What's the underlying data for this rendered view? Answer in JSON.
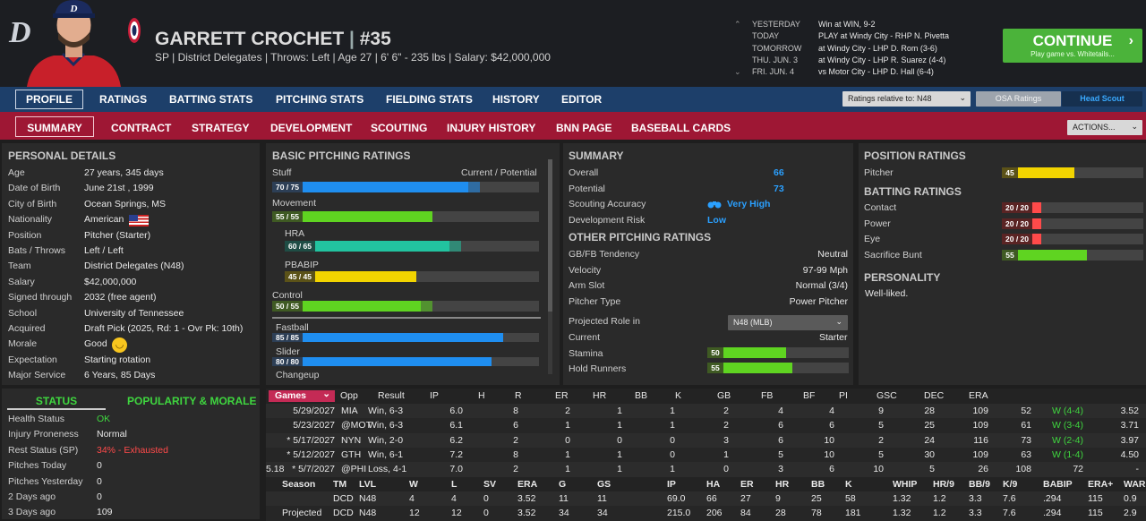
{
  "logo": "D",
  "player": {
    "name": "GARRETT CROCHET",
    "number": "#35",
    "info": "SP | District Delegates  |  Throws: Left  |  Age 27  |  6' 6\" - 235 lbs  |  Salary: $42,000,000"
  },
  "schedule": [
    {
      "day": "YESTERDAY",
      "text": "Win at WIN, 9-2"
    },
    {
      "day": "TODAY",
      "text": "PLAY at Windy City - RHP N. Pivetta"
    },
    {
      "day": "TOMORROW",
      "text": "at Windy City - LHP D. Rom (3-6)"
    },
    {
      "day": "THU. JUN. 3",
      "text": "at Windy City - LHP R. Suarez (4-4)"
    },
    {
      "day": "FRI. JUN. 4",
      "text": "vs Motor City - LHP D. Hall (6-4)"
    }
  ],
  "continue": {
    "label": "CONTINUE",
    "sub": "Play game vs. Whitetails..."
  },
  "nav1": [
    "PROFILE",
    "RATINGS",
    "BATTING STATS",
    "PITCHING STATS",
    "FIELDING STATS",
    "HISTORY",
    "EDITOR"
  ],
  "ratings_relative": "Ratings relative to: N48",
  "osa": "OSA Ratings",
  "head_scout": "Head Scout",
  "nav2": [
    "SUMMARY",
    "CONTRACT",
    "STRATEGY",
    "DEVELOPMENT",
    "SCOUTING",
    "INJURY HISTORY",
    "BNN PAGE",
    "BASEBALL CARDS"
  ],
  "actions": "ACTIONS...",
  "personal": {
    "title": "PERSONAL DETAILS",
    "rows": [
      [
        "Age",
        "27 years, 345 days"
      ],
      [
        "Date of Birth",
        "June 21st , 1999"
      ],
      [
        "City of Birth",
        "Ocean Springs, MS"
      ],
      [
        "Nationality",
        "American"
      ],
      [
        "Position",
        "Pitcher (Starter)"
      ],
      [
        "Bats / Throws",
        "Left / Left"
      ],
      [
        "Team",
        "District Delegates (N48)"
      ],
      [
        "Salary",
        "$42,000,000"
      ],
      [
        "Signed through",
        "2032 (free agent)"
      ],
      [
        "School",
        "University of Tennessee"
      ],
      [
        "Acquired",
        "Draft Pick (2025, Rd: 1 - Ovr Pk: 10th)"
      ],
      [
        "Morale",
        "Good"
      ],
      [
        "Expectation",
        "Starting rotation"
      ],
      [
        "Major Service",
        "6 Years, 85 Days"
      ]
    ]
  },
  "status": {
    "tab1": "STATUS",
    "tab2": "POPULARITY & MORALE",
    "rows": [
      [
        "Health Status",
        "OK"
      ],
      [
        "Injury Proneness",
        "Normal"
      ],
      [
        "Rest Status (SP)",
        "34% - Exhausted"
      ],
      [
        "Pitches Today",
        "0"
      ],
      [
        "Pitches Yesterday",
        "0"
      ],
      [
        "2 Days ago",
        "0"
      ],
      [
        "3 Days ago",
        "109"
      ]
    ]
  },
  "basic": {
    "title": "BASIC PITCHING RATINGS",
    "left": "Stuff",
    "right": "Current / Potential",
    "items": [
      {
        "name": "",
        "label": "70 / 75",
        "cur": 70,
        "pot": 75,
        "color": "#1f8ef0"
      },
      {
        "name": "Movement",
        "label": "55 / 55",
        "cur": 55,
        "pot": 55,
        "color": "#5fd421"
      },
      {
        "name": "HRA",
        "label": "60 / 65",
        "cur": 60,
        "pot": 65,
        "color": "#22c3a0"
      },
      {
        "name": "PBABIP",
        "label": "45 / 45",
        "cur": 45,
        "pot": 45,
        "color": "#f2d400"
      },
      {
        "name": "Control",
        "label": "50 / 55",
        "cur": 50,
        "pot": 55,
        "color": "#5fd421"
      }
    ],
    "pitches": [
      {
        "name": "Fastball",
        "label": "85 / 85",
        "cur": 85,
        "color": "#1f8ef0"
      },
      {
        "name": "Slider",
        "label": "80 / 80",
        "cur": 80,
        "color": "#1f8ef0"
      },
      {
        "name": "Changeup",
        "label": "",
        "cur": 0,
        "color": "#1f8ef0"
      }
    ]
  },
  "summary": {
    "title": "SUMMARY",
    "rows": [
      [
        "Overall",
        "66"
      ],
      [
        "Potential",
        "73"
      ]
    ],
    "scout": [
      "Scouting Accuracy",
      "Very High"
    ],
    "risk": [
      "Development Risk",
      "Low"
    ]
  },
  "other": {
    "title": "OTHER PITCHING RATINGS",
    "rows": [
      [
        "GB/FB Tendency",
        "Neutral"
      ],
      [
        "Velocity",
        "97-99 Mph"
      ],
      [
        "Arm Slot",
        "Normal (3/4)"
      ],
      [
        "Pitcher Type",
        "Power Pitcher"
      ]
    ],
    "role_label": "Projected Role in",
    "role_value": "N48 (MLB)",
    "current_label": "Current",
    "current_value": "Starter",
    "stamina": {
      "name": "Stamina",
      "v": 50
    },
    "hold": {
      "name": "Hold Runners",
      "v": 55
    }
  },
  "position": {
    "title": "POSITION RATINGS",
    "pitcher": {
      "name": "Pitcher",
      "v": 45
    }
  },
  "batting": {
    "title": "BATTING RATINGS",
    "items": [
      {
        "name": "Contact",
        "label": "20 / 20",
        "v": 20
      },
      {
        "name": "Power",
        "label": "20 / 20",
        "v": 20
      },
      {
        "name": "Eye",
        "label": "20 / 20",
        "v": 20
      },
      {
        "name": "Sacrifice Bunt",
        "label": "55",
        "v": 55
      }
    ]
  },
  "personality": {
    "title": "PERSONALITY",
    "text": "Well-liked."
  },
  "games": {
    "tab": "Games",
    "headers": [
      "Opp",
      "Result",
      "IP",
      "H",
      "R",
      "ER",
      "HR",
      "BB",
      "K",
      "GB",
      "FB",
      "BF",
      "PI",
      "GSC",
      "DEC",
      "ERA"
    ],
    "rows": [
      [
        "5/29/2027",
        "MIA",
        "Win, 6-3",
        "6.0",
        "8",
        "2",
        "1",
        "1",
        "2",
        "4",
        "4",
        "9",
        "28",
        "109",
        "52",
        "W (4-4)",
        "3.52"
      ],
      [
        "5/23/2027",
        "@MOT",
        "Win, 6-3",
        "6.1",
        "6",
        "1",
        "1",
        "1",
        "2",
        "6",
        "6",
        "5",
        "25",
        "109",
        "61",
        "W (3-4)",
        "3.71"
      ],
      [
        "* 5/17/2027",
        "NYN",
        "Win, 2-0",
        "6.2",
        "2",
        "0",
        "0",
        "0",
        "3",
        "6",
        "10",
        "2",
        "24",
        "116",
        "73",
        "W (2-4)",
        "3.97"
      ],
      [
        "* 5/12/2027",
        "GTH",
        "Win, 6-1",
        "7.2",
        "8",
        "1",
        "1",
        "0",
        "1",
        "5",
        "10",
        "5",
        "30",
        "109",
        "63",
        "W (1-4)",
        "4.50"
      ],
      [
        "* 5/7/2027",
        "@PHI",
        "Loss, 4-1",
        "7.0",
        "2",
        "1",
        "1",
        "1",
        "0",
        "3",
        "6",
        "10",
        "5",
        "26",
        "108",
        "72",
        "-",
        "5.18"
      ]
    ],
    "season_headers": [
      "Season",
      "TM",
      "LVL",
      "W",
      "L",
      "SV",
      "ERA",
      "G",
      "GS",
      "IP",
      "HA",
      "ER",
      "HR",
      "BB",
      "K",
      "WHIP",
      "HR/9",
      "BB/9",
      "K/9",
      "BABIP",
      "ERA+",
      "WAR"
    ],
    "season_rows": [
      [
        "",
        "DCD",
        "N48",
        "4",
        "4",
        "0",
        "3.52",
        "11",
        "11",
        "69.0",
        "66",
        "27",
        "9",
        "25",
        "58",
        "1.32",
        "1.2",
        "3.3",
        "7.6",
        ".294",
        "115",
        "0.9"
      ],
      [
        "Projected",
        "DCD",
        "N48",
        "12",
        "12",
        "0",
        "3.52",
        "34",
        "34",
        "215.0",
        "206",
        "84",
        "28",
        "78",
        "181",
        "1.32",
        "1.2",
        "3.3",
        "7.6",
        ".294",
        "115",
        "2.9"
      ]
    ]
  },
  "colors": {
    "header": "#1c1e22",
    "nav1": "#1d3f6a",
    "nav2": "#9e1734",
    "continue": "#4bb33a",
    "accent_blue": "#2aa0ff",
    "green": "#3fd63f",
    "red": "#ff4a4a"
  }
}
